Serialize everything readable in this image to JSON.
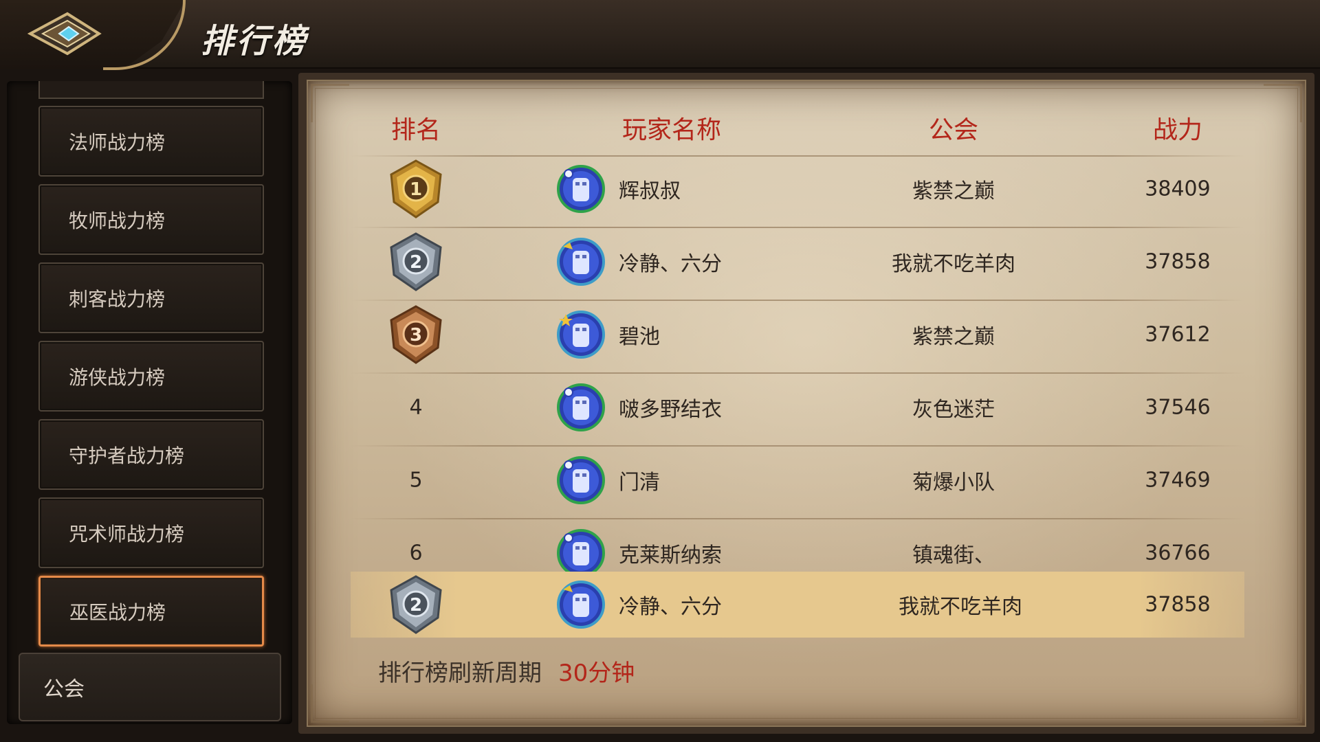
{
  "header": {
    "title": "排行榜",
    "back_icon": "back-arrow-diamond-icon"
  },
  "sidebar": {
    "items": [
      {
        "label": "法师战力榜",
        "active": false
      },
      {
        "label": "牧师战力榜",
        "active": false
      },
      {
        "label": "刺客战力榜",
        "active": false
      },
      {
        "label": "游侠战力榜",
        "active": false
      },
      {
        "label": "守护者战力榜",
        "active": false
      },
      {
        "label": "咒术师战力榜",
        "active": false
      },
      {
        "label": "巫医战力榜",
        "active": true
      }
    ],
    "category": "公会"
  },
  "table": {
    "columns": {
      "rank": "排名",
      "player": "玩家名称",
      "guild": "公会",
      "power": "战力"
    },
    "rows": [
      {
        "rank": "1",
        "medal": "gold",
        "player": "辉叔叔",
        "guild": "紫禁之巅",
        "power": "38409"
      },
      {
        "rank": "2",
        "medal": "silver",
        "player": "冷静、六分",
        "guild": "我就不吃羊肉",
        "power": "37858"
      },
      {
        "rank": "3",
        "medal": "bronze",
        "player": "碧池",
        "guild": "紫禁之巅",
        "power": "37612"
      },
      {
        "rank": "4",
        "medal": "",
        "player": "啵多野结衣",
        "guild": "灰色迷茫",
        "power": "37546"
      },
      {
        "rank": "5",
        "medal": "",
        "player": "门清",
        "guild": "菊爆小队",
        "power": "37469"
      },
      {
        "rank": "6",
        "medal": "",
        "player": "克莱斯纳索",
        "guild": "镇魂街、",
        "power": "36766"
      }
    ],
    "self": {
      "rank": "2",
      "medal": "silver",
      "player": "冷静、六分",
      "guild": "我就不吃羊肉",
      "power": "37858"
    }
  },
  "footer": {
    "refresh_label": "排行榜刷新周期",
    "refresh_value": "30分钟"
  },
  "colors": {
    "header_text": "#b3261a",
    "medal_gold": "#d9a534",
    "medal_silver": "#8d99a6",
    "medal_bronze": "#c07a4a",
    "active_border": "#e58a49",
    "highlight_row": "#e6c88e"
  }
}
